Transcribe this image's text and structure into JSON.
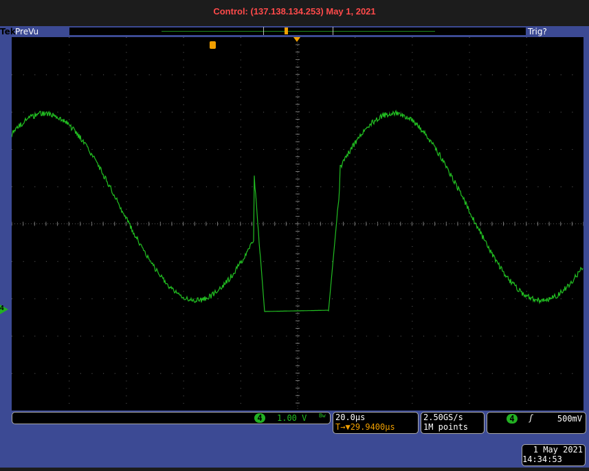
{
  "header": {
    "title": "Control: (137.138.134.253)   May 1, 2021"
  },
  "topbar": {
    "brand": "Tek",
    "mode": "PreVu",
    "trigger_status": "Trig?"
  },
  "channel": {
    "number": "4",
    "scale": "1.00 V",
    "bw_icon": "Bw"
  },
  "horizontal": {
    "timebase": "20.0µs",
    "trigger_offset": "29.9400µs",
    "trigger_prefix": "T→▼"
  },
  "acquisition": {
    "sample_rate": "2.50GS/s",
    "record_length": "1M points"
  },
  "trigger": {
    "channel": "4",
    "slope_icon": "rising-edge",
    "level": "500mV"
  },
  "datetime": {
    "date": "1 May 2021",
    "time": "14:34:53"
  },
  "colors": {
    "trace": "#22c022",
    "marker": "#f2a000",
    "frame": "#3c4a94",
    "title": "#ff4a4a"
  }
}
